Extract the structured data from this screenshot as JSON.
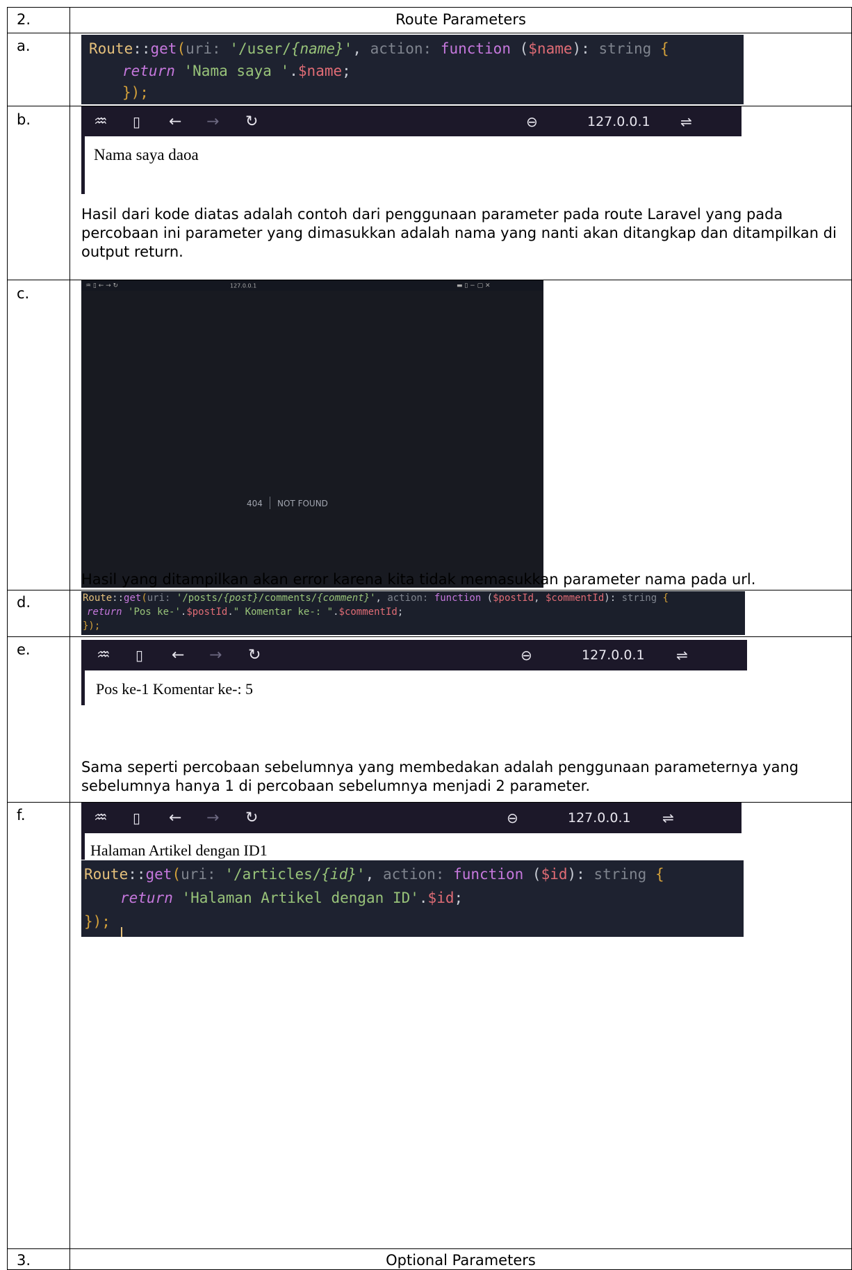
{
  "rows": {
    "sec2": {
      "num": "2.",
      "title": "Route Parameters"
    },
    "a": {
      "label": "a."
    },
    "b": {
      "label": "b."
    },
    "c": {
      "label": "c."
    },
    "d": {
      "label": "d."
    },
    "e": {
      "label": "e."
    },
    "f": {
      "label": "f."
    },
    "sec3": {
      "num": "3.",
      "title": "Optional Parameters"
    }
  },
  "code_a": {
    "l1": [
      "Route",
      "::",
      "get",
      "(",
      "uri:",
      " '/user/",
      "{name}",
      "'",
      ", ",
      "action:",
      " ",
      "function",
      " (",
      "$name",
      "): ",
      "string",
      " {"
    ],
    "l2": [
      "return",
      " '",
      "Nama saya ",
      "'",
      ".",
      "$name",
      ";"
    ],
    "l3": [
      "});"
    ]
  },
  "browser": {
    "url": "127.0.0.1",
    "page_b": "Nama saya daoa",
    "page_e": "Pos ke-1 Komentar ke-: 5",
    "page_f": "Halaman Artikel dengan ID1"
  },
  "browser_c": {
    "url": "127.0.0.1",
    "code": "404",
    "status": "NOT FOUND"
  },
  "text": {
    "b": "Hasil dari kode diatas adalah contoh dari penggunaan parameter pada route Laravel yang pada percobaan ini parameter yang dimasukkan adalah nama yang nanti akan ditangkap dan ditampilkan di output return.",
    "c": "Hasil yang ditampilkan akan error karena kita tidak memasukkan parameter nama pada url.",
    "e": "Sama seperti percobaan sebelumnya yang membedakan adalah penggunaan parameternya yang sebelumnya hanya 1 di percobaan sebelumnya menjadi 2 parameter."
  },
  "code_d": {
    "l1": [
      "Route",
      "::",
      "get",
      "(",
      "uri:",
      " '/posts/",
      "{post}",
      "/comments/",
      "{comment}",
      "'",
      ", ",
      "action:",
      " ",
      "function",
      " (",
      "$postId",
      ", ",
      "$commentId",
      "): ",
      "string",
      " {"
    ],
    "l2": [
      "return",
      " '",
      "Pos ke-",
      "'",
      ".",
      "$postId",
      ".",
      "\" Komentar ke-: \"",
      ".",
      "$commentId",
      ";"
    ],
    "l3": [
      "});"
    ]
  },
  "code_f": {
    "l1": [
      "Route",
      "::",
      "get",
      "(",
      "uri:",
      " '/articles/",
      "{id}",
      "'",
      ", ",
      "action:",
      " ",
      "function",
      " (",
      "$id",
      "): ",
      "string",
      " {"
    ],
    "l2": [
      "return",
      " '",
      "Halaman Artikel dengan ID",
      "'",
      ".",
      "$id",
      ";"
    ],
    "l3": [
      "});"
    ]
  },
  "colors": {
    "editor_bg": "#1e2230",
    "browser_bar": "#1c1829",
    "grid": "#000000"
  }
}
